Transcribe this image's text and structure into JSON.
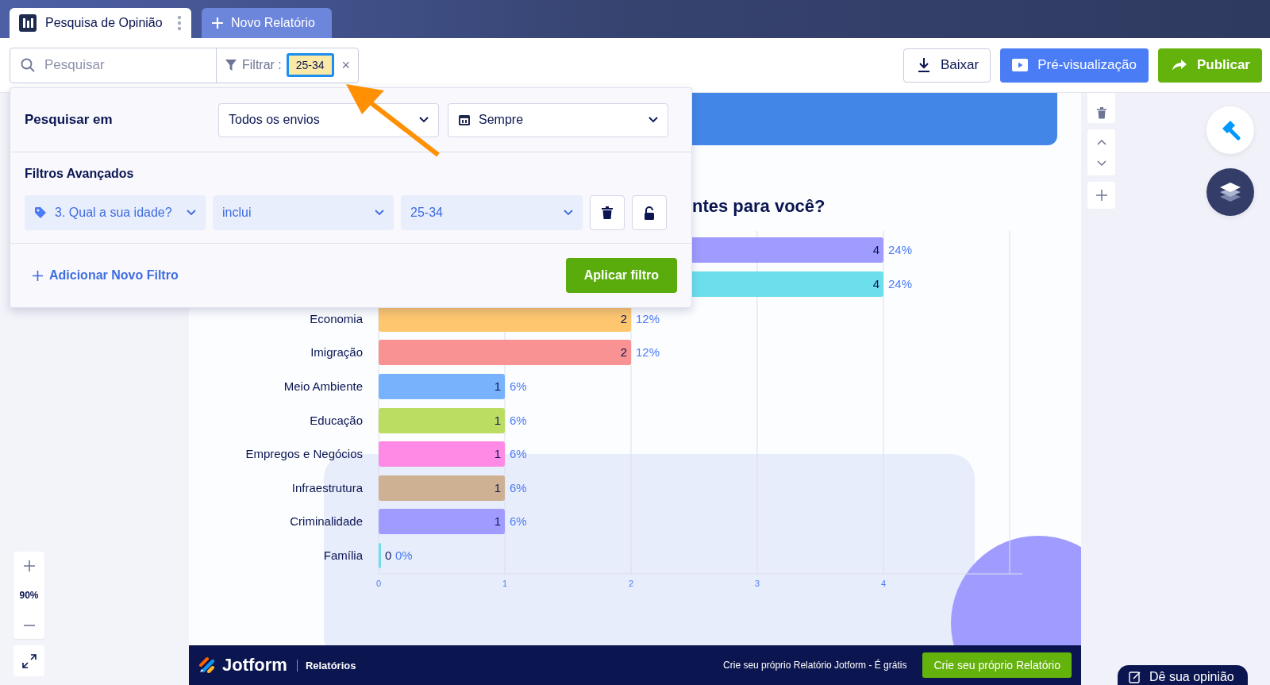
{
  "tabs": [
    {
      "label": "Pesquisa de Opinião",
      "selected": true,
      "kind": "report"
    },
    {
      "label": "Novo Relatório",
      "selected": false,
      "kind": "new"
    }
  ],
  "toolbar": {
    "search": {
      "placeholder": "Pesquisar"
    },
    "filter": {
      "label": "Filtrar :",
      "chip": "25-34",
      "clear": "×"
    },
    "buttons": [
      {
        "label": "Baixar",
        "kind": "download"
      },
      {
        "label": "Pré-visualização",
        "kind": "preview"
      },
      {
        "label": "Publicar",
        "kind": "publish"
      }
    ]
  },
  "annotation": {
    "highlight_chip": true,
    "arrow": true
  },
  "filter_panel": {
    "search_in": {
      "label": "Pesquisar em",
      "scope": "Todos os envios",
      "period": "Sempre"
    },
    "advanced": {
      "title": "Filtros Avançados",
      "question": "3. Qual a sua idade?",
      "operator": "inclui",
      "value": "25-34"
    },
    "add_filter": "Adicionar Novo Filtro",
    "apply": "Aplicar filtro"
  },
  "report": {
    "chart_data": {
      "type": "bar",
      "orientation": "horizontal",
      "title": "ntes para você?",
      "categories": [
        null,
        null,
        "Economia",
        "Imigração",
        "Meio Ambiente",
        "Educação",
        "Empregos e Negócios",
        "Infraestrutura",
        "Criminalidade",
        "Família"
      ],
      "series": [
        {
          "values": [
            4,
            4,
            2,
            2,
            1,
            1,
            1,
            1,
            1,
            0
          ]
        }
      ],
      "colors": [
        "#a09cff",
        "#6be0ec",
        "#fdc66f",
        "#f99292",
        "#78b2fd",
        "#bbdd62",
        "#ff8ae5",
        "#ceb092",
        "#a09cff",
        "#6be0ec"
      ],
      "data_labels": true,
      "value_labels": [
        "24%",
        "24%",
        "12%",
        "12%",
        "6%",
        "6%",
        "6%",
        "6%",
        "6%",
        "0%"
      ],
      "xlim": [
        0,
        5
      ],
      "xticks": [
        0,
        1,
        2,
        3,
        4
      ],
      "grid": true
    }
  },
  "zoom": {
    "level": "90%"
  },
  "footer": {
    "brand": "Jotform",
    "section": "Relatórios",
    "promo": "Crie seu próprio Relatório Jotform - É grátis",
    "cta": "Crie seu próprio Relatório"
  },
  "feedback_button": "Dê sua opinião"
}
